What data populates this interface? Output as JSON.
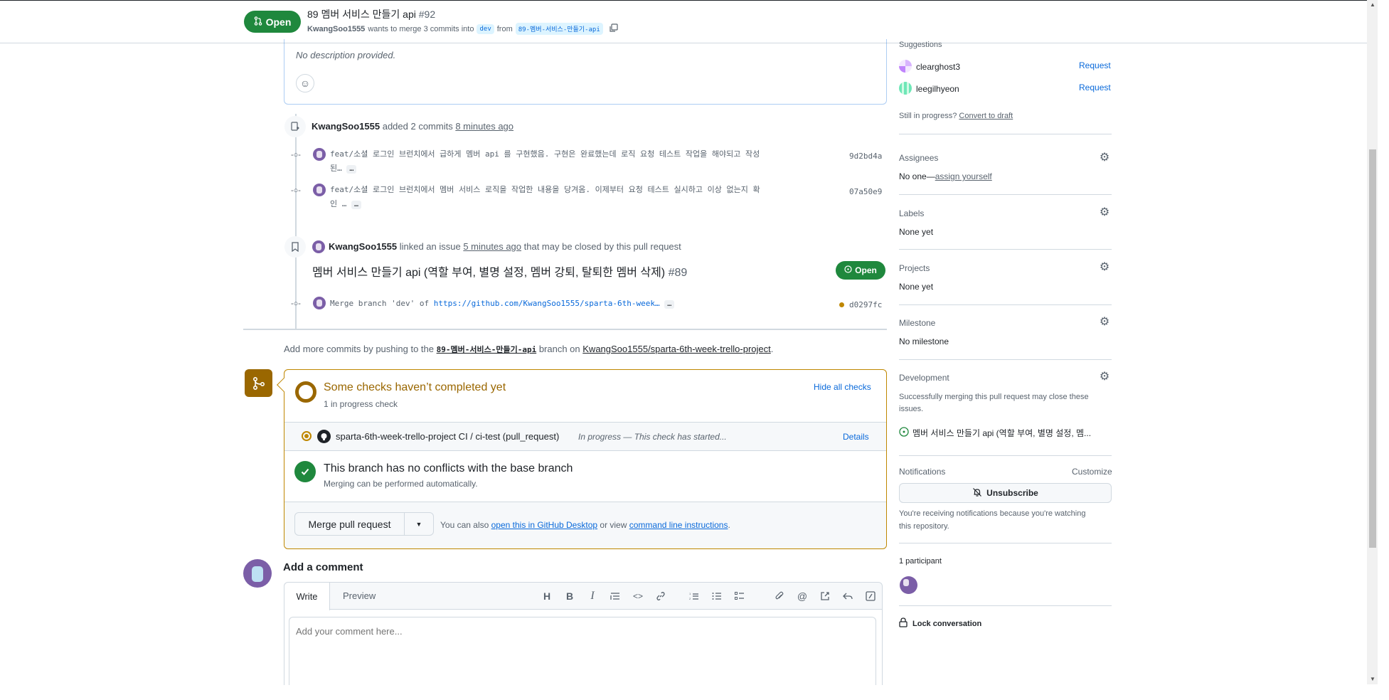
{
  "header": {
    "state_label": "Open",
    "title": "89 멤버 서비스 만들기 api",
    "number": "#92",
    "author": "KwangSoo1555",
    "merge_text": "wants to merge 3 commits into",
    "base_branch": "dev",
    "from_text": "from",
    "head_branch": "89-멤버-서비스-만들기-api"
  },
  "description": {
    "text": "No description provided."
  },
  "timeline": {
    "added_commits": {
      "author": "KwangSoo1555",
      "action": "added 2 commits",
      "time": "8 minutes ago"
    },
    "commits": [
      {
        "line1": "feat/소셜 로그인 브런치에서 급하게 멤버 api 를 구현했음. 구현은 완료했는데 로직 요청 테스트 작업을 해야되고 작성",
        "line2": "된…",
        "sha": "9d2bd4a"
      },
      {
        "line1": "feat/소셜 로그인 브런치에서 멤버 서비스 로직을 작업한 내용을 당겨옴. 이제부터 요청 테스트 실시하고 이상 없는지 확",
        "line2": "인 …",
        "sha": "07a50e9"
      }
    ],
    "linked_issue": {
      "author": "KwangSoo1555",
      "action": "linked an issue",
      "time": "5 minutes ago",
      "suffix": "that may be closed by this pull request",
      "issue_title": "멤버 서비스 만들기 api (역할 부여, 별명 설정, 멤버 강퇴, 탈퇴한 멤버 삭제)",
      "issue_number": "#89",
      "issue_state": "Open"
    },
    "merge_commit": {
      "message_prefix": "Merge branch 'dev' of",
      "message_link": "https://github.com/KwangSoo1555/sparta-6th-week…",
      "sha": "d0297fc"
    },
    "add_more": {
      "prefix": "Add more commits by pushing to the",
      "branch": "89-멤버-서비스-만들기-api",
      "middle": "branch on",
      "repo": "KwangSoo1555/sparta-6th-week-trello-project",
      "suffix": "."
    }
  },
  "merge_box": {
    "checks_title": "Some checks haven’t completed yet",
    "checks_sub": "1 in progress check",
    "hide_checks": "Hide all checks",
    "check_name": "sparta-6th-week-trello-project CI / ci-test (pull_request)",
    "check_status": "In progress — This check has started...",
    "details": "Details",
    "noconflict_title": "This branch has no conflicts with the base branch",
    "noconflict_sub": "Merging can be performed automatically.",
    "merge_button": "Merge pull request",
    "also_prefix": "You can also",
    "also_link1": "open this in GitHub Desktop",
    "also_mid": "or view",
    "also_link2": "command line instructions",
    "also_suffix": "."
  },
  "comment": {
    "heading": "Add a comment",
    "tab_write": "Write",
    "tab_preview": "Preview",
    "placeholder": "Add your comment here..."
  },
  "sidebar": {
    "suggestions_label": "Suggestions",
    "reviewers": [
      {
        "name": "clearghost3",
        "action": "Request"
      },
      {
        "name": "leegilhyeon",
        "action": "Request"
      }
    ],
    "still_in_progress": "Still in progress?",
    "convert_to_draft": "Convert to draft",
    "assignees_label": "Assignees",
    "assignees_value_prefix": "No one—",
    "assign_yourself": "assign yourself",
    "labels_label": "Labels",
    "labels_value": "None yet",
    "projects_label": "Projects",
    "projects_value": "None yet",
    "milestone_label": "Milestone",
    "milestone_value": "No milestone",
    "development_label": "Development",
    "development_text1": "Successfully merging this pull request may close these",
    "development_text2": "issues.",
    "development_issue": "멤버 서비스 만들기 api (역할 부여, 별명 설정, 멤...",
    "notifications_label": "Notifications",
    "customize": "Customize",
    "unsubscribe": "Unsubscribe",
    "notif_text1": "You're receiving notifications because you're watching",
    "notif_text2": "this repository.",
    "participants_label": "1 participant",
    "lock": "Lock conversation"
  },
  "colors": {
    "open_green": "#1f883d",
    "pending_yellow": "#9a6700",
    "link_blue": "#0969da"
  }
}
